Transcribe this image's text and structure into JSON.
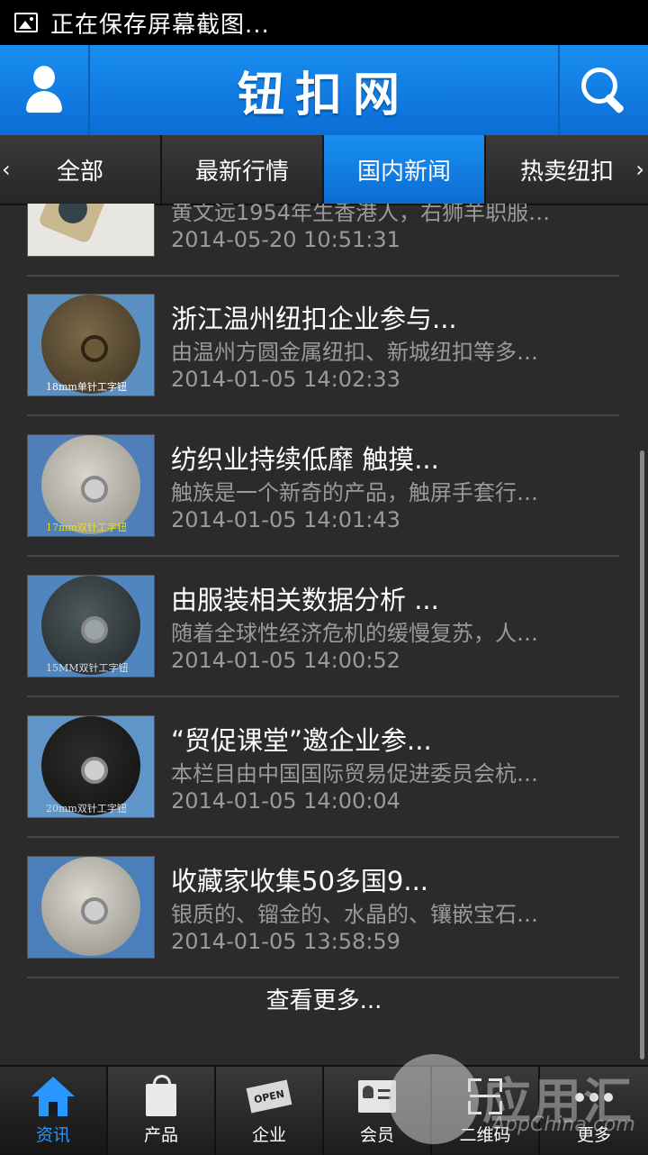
{
  "status_bar": {
    "text": "正在保存屏幕截图..."
  },
  "header": {
    "title": "钮扣网"
  },
  "tabs": [
    {
      "label": "全部"
    },
    {
      "label": "最新行情"
    },
    {
      "label": "国内新闻",
      "active": true
    },
    {
      "label": "热卖纽扣"
    }
  ],
  "tab_arrows": {
    "left": "‹",
    "right": "›"
  },
  "news": [
    {
      "title": "",
      "desc": "黄文远1954年生香港人，右狮羊职服…",
      "time": "2014-05-20 10:51:31",
      "thumb_caption": ""
    },
    {
      "title": "浙江温州纽扣企业参与...",
      "desc": "由温州方圆金属纽扣、新城纽扣等多…",
      "time": "2014-01-05 14:02:33",
      "thumb_caption": "18mm单针工字钮"
    },
    {
      "title": "纺织业持续低靡 触摸...",
      "desc": "触族是一个新奇的产品，触屏手套行…",
      "time": "2014-01-05 14:01:43",
      "thumb_caption": "17mm双针工字钮"
    },
    {
      "title": "由服装相关数据分析 ...",
      "desc": "随着全球性经济危机的缓慢复苏，人…",
      "time": "2014-01-05 14:00:52",
      "thumb_caption": "15MM双针工字钮"
    },
    {
      "title": "“贸促课堂”邀企业参...",
      "desc": "本栏目由中国国际贸易促进委员会杭…",
      "time": "2014-01-05 14:00:04",
      "thumb_caption": "20mm双针工字钮"
    },
    {
      "title": "收藏家收集50多国9...",
      "desc": "银质的、镏金的、水晶的、镶嵌宝石…",
      "time": "2014-01-05 13:58:59",
      "thumb_caption": ""
    }
  ],
  "load_more": "查看更多...",
  "bottom_nav": [
    {
      "label": "资讯",
      "icon": "home-icon",
      "active": true
    },
    {
      "label": "产品",
      "icon": "shopping-bag-icon"
    },
    {
      "label": "企业",
      "icon": "open-sign-icon"
    },
    {
      "label": "会员",
      "icon": "member-card-icon"
    },
    {
      "label": "二维码",
      "icon": "qr-code-icon"
    },
    {
      "label": "更多",
      "icon": "more-dots-icon"
    }
  ],
  "watermark": {
    "text": "应用汇",
    "sub": "AppChina.com"
  },
  "colors": {
    "accent": "#1a8ef0",
    "background": "#2b2b2b",
    "muted_text": "#9a9a9a"
  }
}
